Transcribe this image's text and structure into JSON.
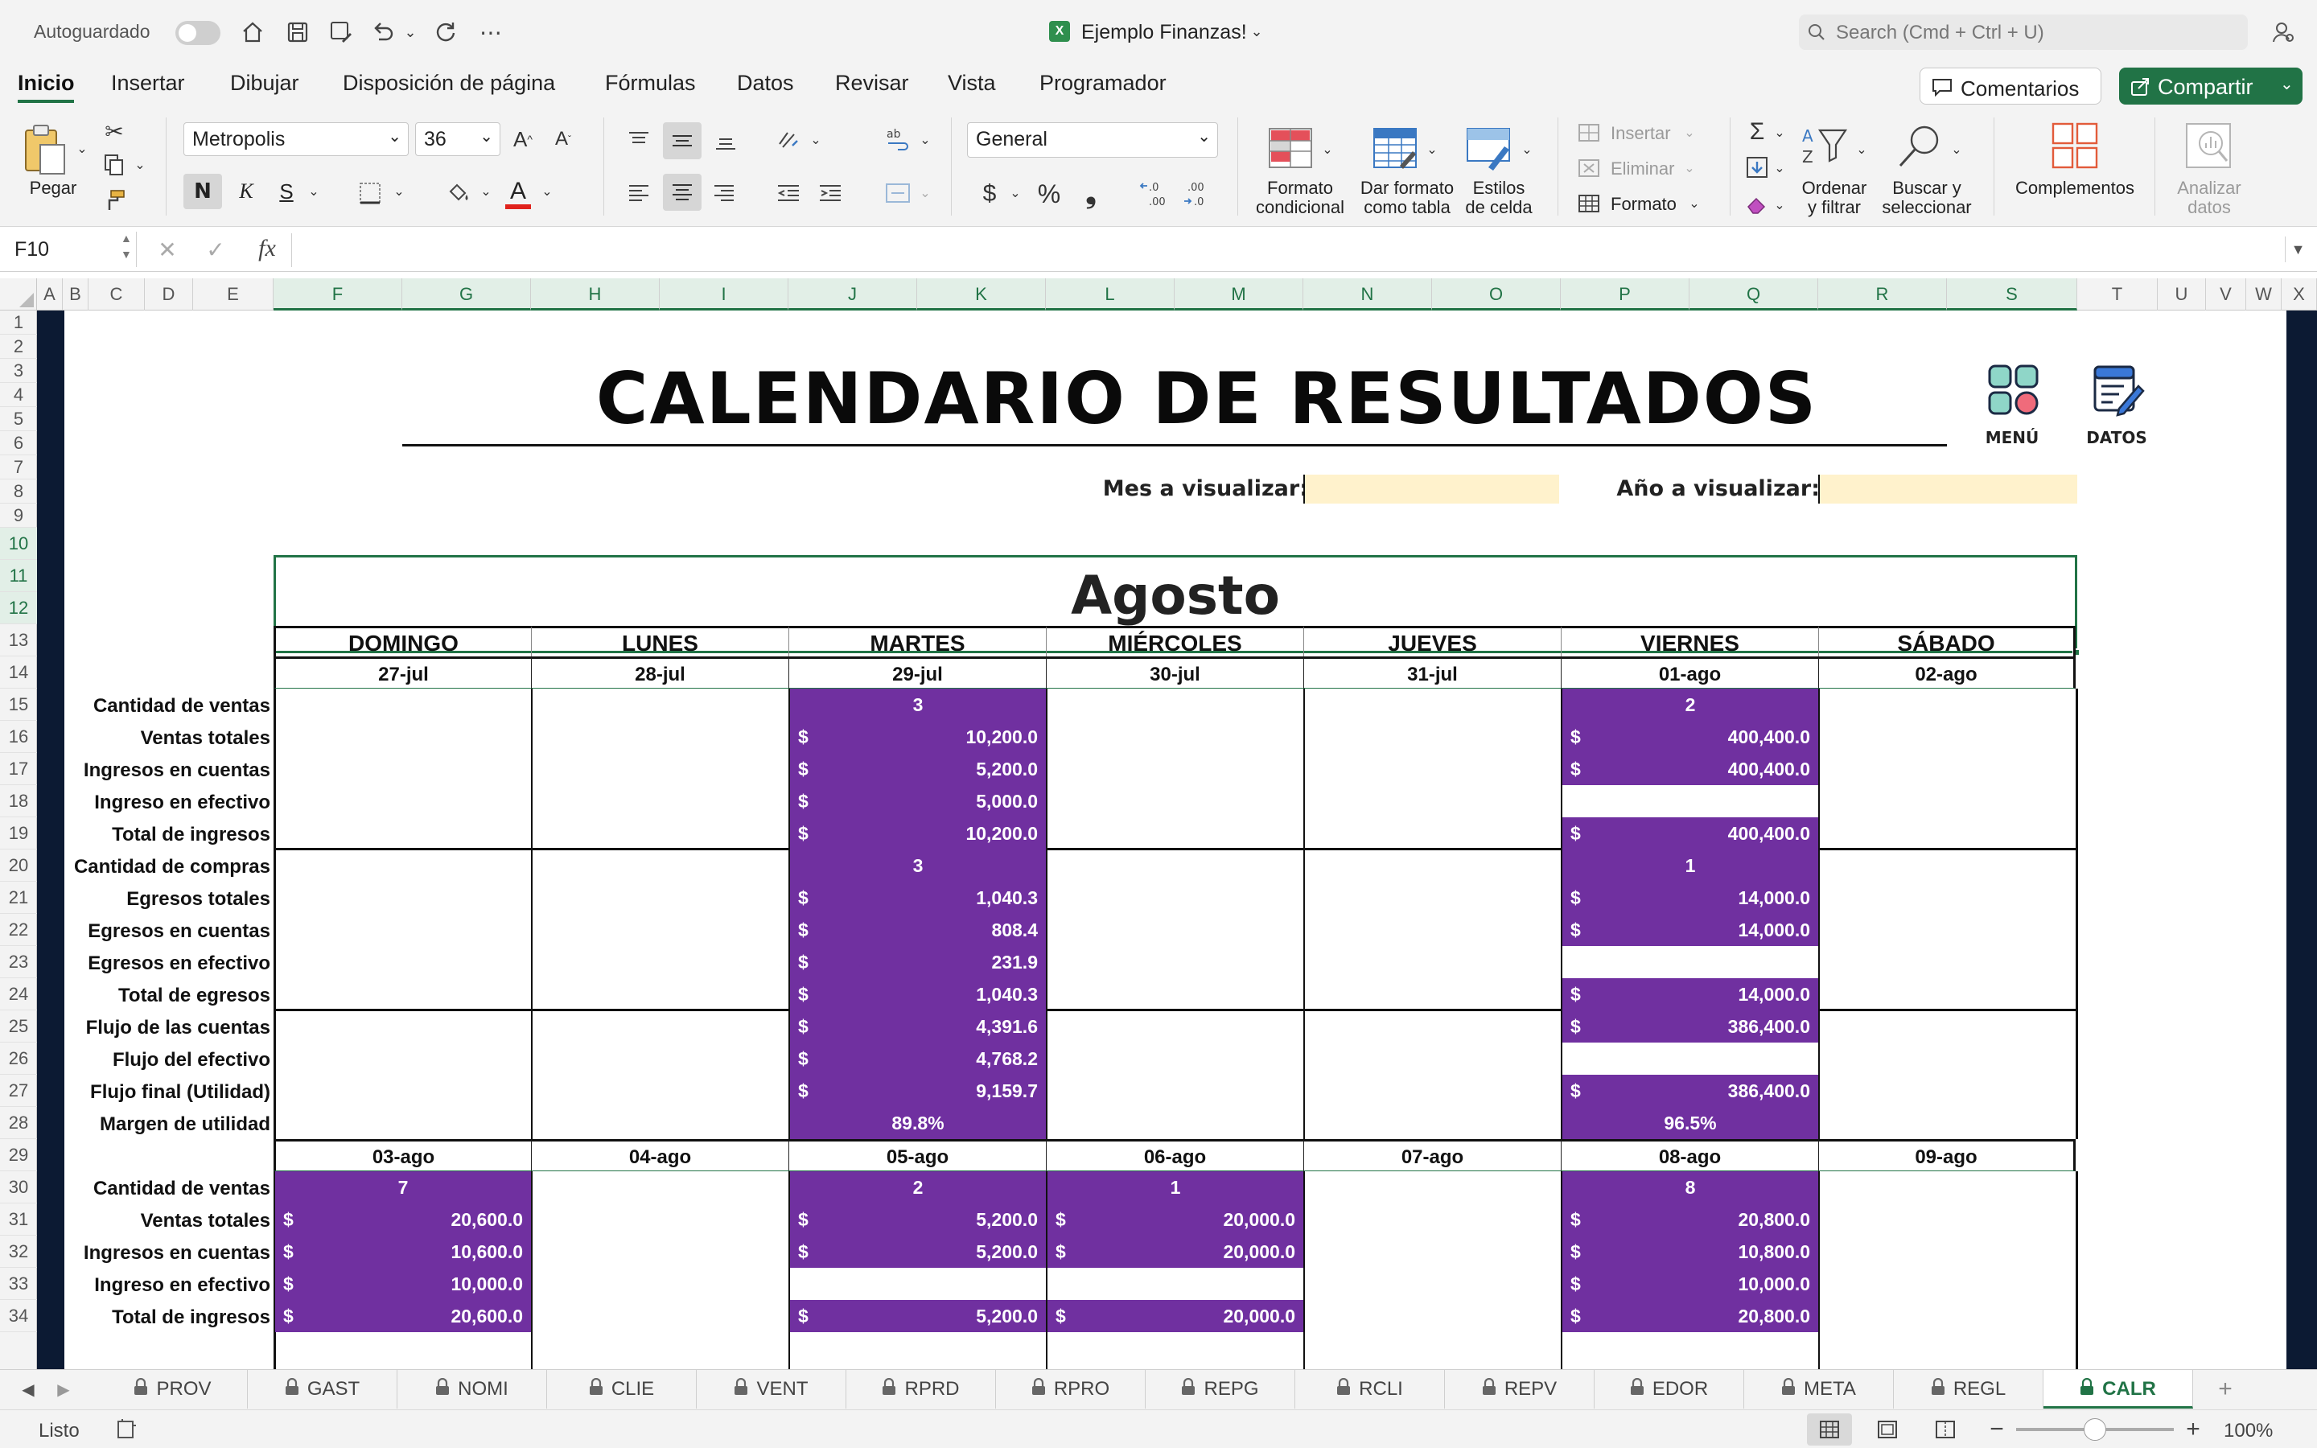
{
  "titlebar": {
    "autosave_label": "Autoguardado",
    "doc_title": "Ejemplo Finanzas!",
    "search_placeholder": "Search (Cmd + Ctrl + U)"
  },
  "menu": {
    "items": [
      "Inicio",
      "Insertar",
      "Dibujar",
      "Disposición de página",
      "Fórmulas",
      "Datos",
      "Revisar",
      "Vista",
      "Programador"
    ],
    "comments_label": "Comentarios",
    "share_label": "Compartir"
  },
  "ribbon": {
    "paste_label": "Pegar",
    "font_name": "Metropolis",
    "font_size": "36",
    "number_format": "General",
    "bold_label": "N",
    "italic_label": "K",
    "underline_label": "S",
    "cond_format": "Formato condicional",
    "cond_format_l1": "Formato",
    "cond_format_l2": "condicional",
    "table_format_l1": "Dar formato",
    "table_format_l2": "como tabla",
    "cell_styles_l1": "Estilos",
    "cell_styles_l2": "de celda",
    "insert_label": "Insertar",
    "delete_label": "Eliminar",
    "format_label": "Formato",
    "sort_l1": "Ordenar",
    "sort_l2": "y filtrar",
    "find_l1": "Buscar y",
    "find_l2": "seleccionar",
    "addins_label": "Complementos",
    "analyze_l1": "Analizar",
    "analyze_l2": "datos"
  },
  "formula_bar": {
    "name_box": "F10",
    "fx": "fx",
    "content": ""
  },
  "columns": [
    "A",
    "B",
    "C",
    "D",
    "E",
    "F",
    "G",
    "H",
    "I",
    "J",
    "K",
    "L",
    "M",
    "N",
    "O",
    "P",
    "Q",
    "R",
    "S",
    "T",
    "U",
    "V",
    "W",
    "X"
  ],
  "rows": [
    "1",
    "2",
    "3",
    "4",
    "5",
    "6",
    "7",
    "8",
    "9",
    "10",
    "11",
    "12",
    "13",
    "14",
    "15",
    "16",
    "17",
    "18",
    "19",
    "20",
    "21",
    "22",
    "23",
    "24",
    "25",
    "26",
    "27",
    "28",
    "29",
    "30",
    "31",
    "32",
    "33",
    "34"
  ],
  "sheet": {
    "title": "CALENDARIO DE RESULTADOS",
    "menu_label": "MENÚ",
    "data_label": "DATOS",
    "month_prompt": "Mes a visualizar:",
    "year_prompt": "Año a visualizar:",
    "month_value": "",
    "year_value": "",
    "month_title": "Agosto",
    "days": [
      "DOMINGO",
      "LUNES",
      "MARTES",
      "MIÉRCOLES",
      "JUEVES",
      "VIERNES",
      "SÁBADO"
    ],
    "week1_dates": [
      "27-jul",
      "28-jul",
      "29-jul",
      "30-jul",
      "31-jul",
      "01-ago",
      "02-ago"
    ],
    "week2_dates": [
      "03-ago",
      "04-ago",
      "05-ago",
      "06-ago",
      "07-ago",
      "08-ago",
      "09-ago"
    ],
    "row_labels_w1": [
      "Cantidad de ventas",
      "Ventas totales",
      "Ingresos en cuentas",
      "Ingreso en efectivo",
      "Total de ingresos",
      "Cantidad de compras",
      "Egresos totales",
      "Egresos en cuentas",
      "Egresos en efectivo",
      "Total de egresos",
      "Flujo de las cuentas",
      "Flujo del efectivo",
      "Flujo final (Utilidad)",
      "Margen de utilidad"
    ],
    "row_labels_w2": [
      "Cantidad de ventas",
      "Ventas totales",
      "Ingresos en cuentas",
      "Ingreso en efectivo",
      "Total de ingresos"
    ],
    "currency": "$",
    "tue_w1": {
      "qty_sales": "3",
      "sales": "10,200.0",
      "in_acc": "5,200.0",
      "in_cash": "5,000.0",
      "in_total": "10,200.0",
      "qty_buy": "3",
      "exp": "1,040.3",
      "exp_acc": "808.4",
      "exp_cash": "231.9",
      "exp_total": "1,040.3",
      "flow_acc": "4,391.6",
      "flow_cash": "4,768.2",
      "flow_final": "9,159.7",
      "margin": "89.8%"
    },
    "fri_w1": {
      "qty_sales": "2",
      "sales": "400,400.0",
      "in_acc": "400,400.0",
      "in_total": "400,400.0",
      "qty_buy": "1",
      "exp": "14,000.0",
      "exp_acc": "14,000.0",
      "exp_total": "14,000.0",
      "flow_acc": "386,400.0",
      "flow_final": "386,400.0",
      "margin": "96.5%"
    },
    "sun_w2": {
      "qty_sales": "7",
      "sales": "20,600.0",
      "in_acc": "10,600.0",
      "in_cash": "10,000.0",
      "in_total": "20,600.0"
    },
    "tue_w2": {
      "qty_sales": "2",
      "sales": "5,200.0",
      "in_acc": "5,200.0",
      "in_total": "5,200.0"
    },
    "wed_w2": {
      "qty_sales": "1",
      "sales": "20,000.0",
      "in_acc": "20,000.0",
      "in_total": "20,000.0"
    },
    "fri_w2": {
      "qty_sales": "8",
      "sales": "20,800.0",
      "in_acc": "10,800.0",
      "in_cash": "10,000.0",
      "in_total": "20,800.0"
    }
  },
  "tabs": [
    "PROV",
    "GAST",
    "NOMI",
    "CLIE",
    "VENT",
    "RPRD",
    "RPRO",
    "REPG",
    "RCLI",
    "REPV",
    "EDOR",
    "META",
    "REGL",
    "CALR"
  ],
  "active_tab": "CALR",
  "status": {
    "ready": "Listo",
    "zoom": "100%"
  },
  "colors": {
    "accent": "#217346",
    "purple": "#7030a0",
    "input_fill": "#fff2cc",
    "navy": "#0c1a33"
  }
}
